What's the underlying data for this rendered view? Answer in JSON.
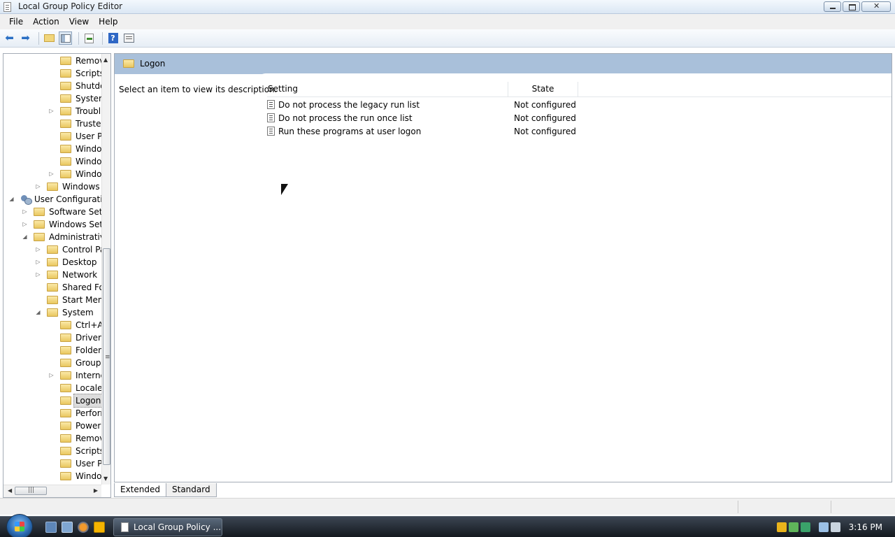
{
  "window": {
    "title": "Local Group Policy Editor"
  },
  "menu": [
    "File",
    "Action",
    "View",
    "Help"
  ],
  "toolbar": {
    "icons": [
      "back-arrow-icon",
      "forward-arrow-icon",
      "up-folder-icon",
      "show-hide-tree-icon",
      "export-list-icon",
      "help-icon",
      "properties-icon"
    ]
  },
  "tree": {
    "items": [
      {
        "label": "Remov",
        "expander": "",
        "depth": 4
      },
      {
        "label": "Scripts",
        "expander": "",
        "depth": 4
      },
      {
        "label": "Shutdo",
        "expander": "",
        "depth": 4
      },
      {
        "label": "System",
        "expander": "",
        "depth": 4
      },
      {
        "label": "Troubl",
        "expander": "collapsed",
        "depth": 4
      },
      {
        "label": "Truste",
        "expander": "",
        "depth": 4
      },
      {
        "label": "User Pr",
        "expander": "",
        "depth": 4
      },
      {
        "label": "Windo",
        "expander": "",
        "depth": 4
      },
      {
        "label": "Windo",
        "expander": "",
        "depth": 4
      },
      {
        "label": "Windo",
        "expander": "collapsed",
        "depth": 4
      },
      {
        "label": "Windows",
        "expander": "collapsed",
        "depth": 3
      },
      {
        "label": "User Configuratio",
        "expander": "expanded",
        "depth": 1,
        "icon": "gp"
      },
      {
        "label": "Software Setti",
        "expander": "collapsed",
        "depth": 2
      },
      {
        "label": "Windows Sett",
        "expander": "collapsed",
        "depth": 2
      },
      {
        "label": "Administrative",
        "expander": "expanded",
        "depth": 2
      },
      {
        "label": "Control Pa",
        "expander": "collapsed",
        "depth": 3
      },
      {
        "label": "Desktop",
        "expander": "collapsed",
        "depth": 3
      },
      {
        "label": "Network",
        "expander": "collapsed",
        "depth": 3
      },
      {
        "label": "Shared Fol",
        "expander": "",
        "depth": 3
      },
      {
        "label": "Start Menu",
        "expander": "",
        "depth": 3
      },
      {
        "label": "System",
        "expander": "expanded",
        "depth": 3
      },
      {
        "label": "Ctrl+A",
        "expander": "",
        "depth": 4
      },
      {
        "label": "Driver I",
        "expander": "",
        "depth": 4
      },
      {
        "label": "Folder",
        "expander": "",
        "depth": 4
      },
      {
        "label": "Group",
        "expander": "",
        "depth": 4
      },
      {
        "label": "Interne",
        "expander": "collapsed",
        "depth": 4
      },
      {
        "label": "Locale",
        "expander": "",
        "depth": 4
      },
      {
        "label": "Logon",
        "expander": "",
        "depth": 4,
        "selected": true
      },
      {
        "label": "Perforn",
        "expander": "",
        "depth": 4
      },
      {
        "label": "Power",
        "expander": "",
        "depth": 4
      },
      {
        "label": "Remov",
        "expander": "",
        "depth": 4
      },
      {
        "label": "Scripts",
        "expander": "",
        "depth": 4
      },
      {
        "label": "User Pr",
        "expander": "",
        "depth": 4
      },
      {
        "label": "Windo",
        "expander": "",
        "depth": 4
      }
    ],
    "hscroll_grip": "|||",
    "vscroll_grip": "≡"
  },
  "detail": {
    "header": "Logon",
    "description": "Select an item to view its description.",
    "columns": {
      "setting": "Setting",
      "state": "State"
    },
    "rows": [
      {
        "setting": "Do not process the legacy run list",
        "state": "Not configured"
      },
      {
        "setting": "Do not process the run once list",
        "state": "Not configured"
      },
      {
        "setting": "Run these programs at user logon",
        "state": "Not configured"
      }
    ]
  },
  "tabs": [
    "Extended",
    "Standard"
  ],
  "taskbar": {
    "task_label": "Local Group Policy ...",
    "clock": "3:16 PM",
    "quicklaunch": [
      "show-desktop-icon",
      "switch-windows-icon",
      "firefox-icon",
      "media-player-icon"
    ],
    "tray": [
      "security-shield-icon",
      "network-status-icon",
      "tray-app-icon",
      "display-icon",
      "volume-muted-icon"
    ]
  },
  "colors": {
    "header_band": "#a9c0da",
    "taskbar": "#1e252e",
    "selection": "#dcdcdc"
  }
}
